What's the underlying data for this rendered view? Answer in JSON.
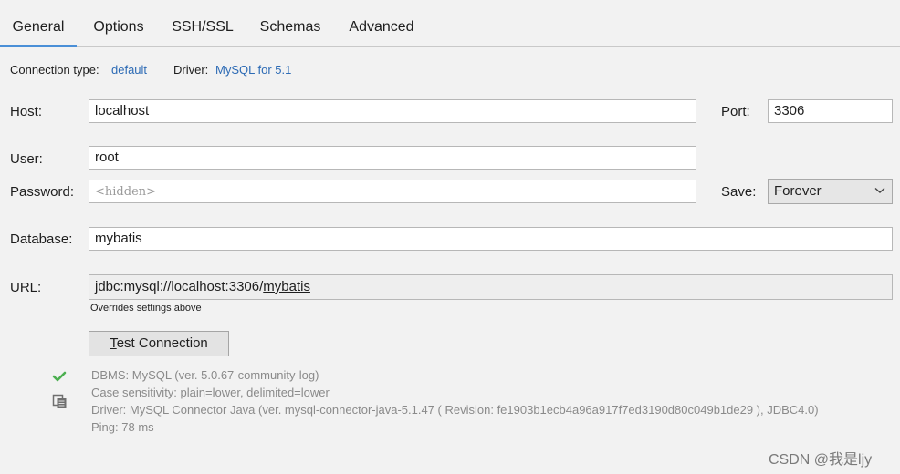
{
  "tabs": [
    {
      "label": "General",
      "active": true
    },
    {
      "label": "Options",
      "active": false
    },
    {
      "label": "SSH/SSL",
      "active": false
    },
    {
      "label": "Schemas",
      "active": false
    },
    {
      "label": "Advanced",
      "active": false
    }
  ],
  "info": {
    "connection_type_label": "Connection type:",
    "connection_type_value": "default",
    "driver_label": "Driver:",
    "driver_value": "MySQL for 5.1"
  },
  "form": {
    "host_label": "Host:",
    "host_value": "localhost",
    "port_label": "Port:",
    "port_value": "3306",
    "user_label": "User:",
    "user_value": "root",
    "password_label": "Password:",
    "password_placeholder": "<hidden>",
    "save_label": "Save:",
    "save_value": "Forever",
    "database_label": "Database:",
    "database_value": "mybatis",
    "url_label": "URL:",
    "url_prefix": "jdbc:mysql://localhost:3306/",
    "url_db": "mybatis",
    "url_note": "Overrides settings above"
  },
  "test_button": {
    "mnemonic": "T",
    "rest": "est Connection"
  },
  "status": {
    "lines": [
      "DBMS: MySQL (ver. 5.0.67-community-log)",
      "Case sensitivity: plain=lower, delimited=lower",
      "Driver: MySQL Connector Java (ver. mysql-connector-java-5.1.47 ( Revision: fe1903b1ecb4a96a917f7ed3190d80c049b1de29 ), JDBC4.0)",
      "Ping: 78 ms"
    ],
    "success_color": "#4caf50"
  },
  "watermark": "CSDN @我是ljy"
}
